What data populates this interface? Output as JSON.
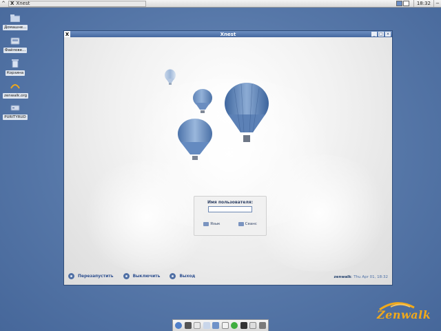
{
  "top_panel": {
    "menu_icon": "xfce-menu-icon",
    "task_title": "Xnest",
    "workspaces": 2,
    "active_workspace": 1,
    "clock": "18:32",
    "action_button": "−"
  },
  "desktop_icons": [
    {
      "label": "Домашне...",
      "icon": "home-folder-icon"
    },
    {
      "label": "Файлове...",
      "icon": "filesystem-icon"
    },
    {
      "label": "Корзина",
      "icon": "trash-icon"
    },
    {
      "label": "zenwalk.org",
      "icon": "web-link-icon"
    },
    {
      "label": "PURITYRUD",
      "icon": "drive-icon"
    }
  ],
  "window": {
    "title": "Xnest",
    "controls": [
      "_",
      "□",
      "×"
    ]
  },
  "login": {
    "prompt": "Имя пользователя:",
    "username_value": "",
    "ok_label": "Язык",
    "cancel_label": "Сеанс"
  },
  "actions": {
    "restart": "Перезапустить",
    "shutdown": "Выключить",
    "exit": "Выход"
  },
  "hostinfo": {
    "host": "zenwalk",
    "datetime": ": Thu Apr 01, 18:32"
  },
  "dock": {
    "icons": [
      "browser-icon",
      "terminal-icon",
      "mail-icon",
      "files-icon",
      "folder-icon",
      "chat-icon",
      "settings-icon",
      "network-icon",
      "document-icon",
      "media-icon"
    ]
  },
  "branding": {
    "logo_text": "Zenwalk",
    "accent": "#f0a91b"
  }
}
